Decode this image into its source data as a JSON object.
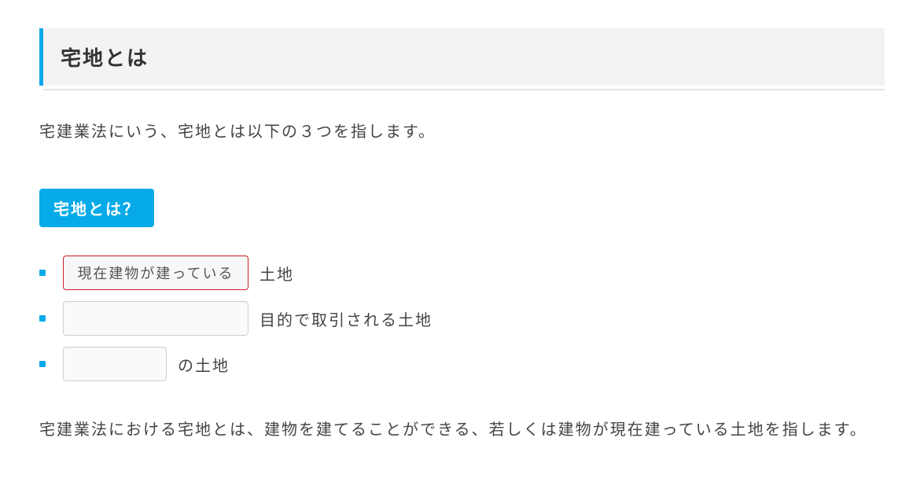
{
  "heading": "宅地とは",
  "intro": "宅建業法にいう、宅地とは以下の３つを指します。",
  "badge": "宅地とは？",
  "items": [
    {
      "blank_value": "現在建物が建っている",
      "after": "土地",
      "answered": true
    },
    {
      "blank_value": "",
      "after": "目的で取引される土地",
      "answered": false
    },
    {
      "blank_value": "",
      "after": "の土地",
      "answered": false
    }
  ],
  "follow": "宅建業法における宅地とは、建物を建てることができる、若しくは建物が現在建っている土地を指します。"
}
